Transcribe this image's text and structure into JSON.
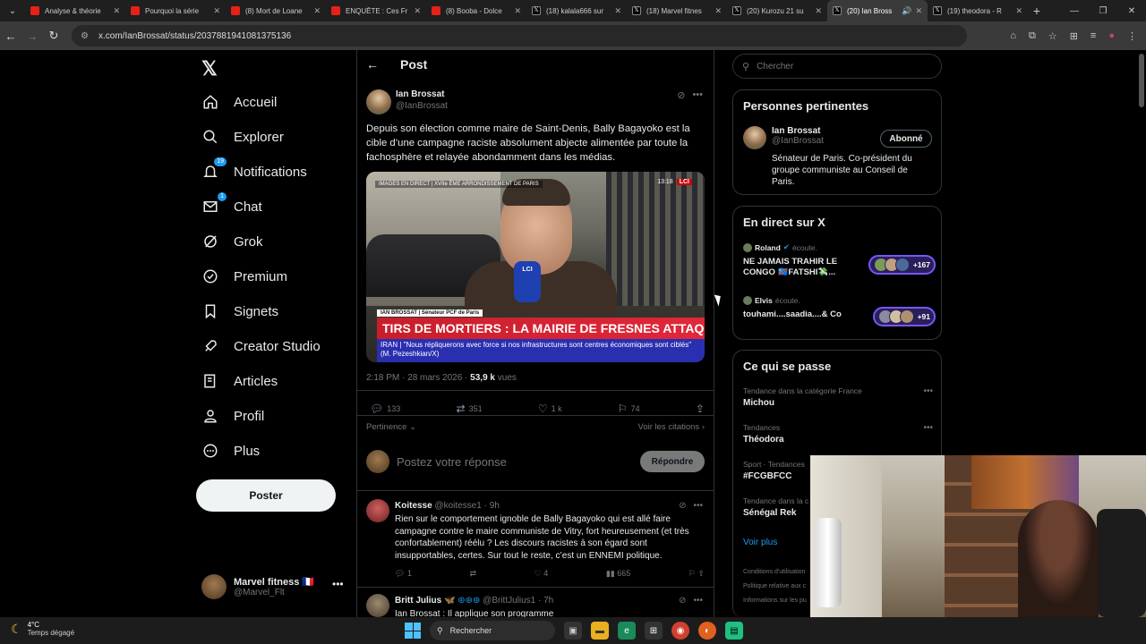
{
  "browser": {
    "tabs": [
      {
        "title": "Analyse & théorie",
        "kind": "yt"
      },
      {
        "title": "Pourquoi la série",
        "kind": "yt"
      },
      {
        "title": "(8) Mort de Loane",
        "kind": "yt"
      },
      {
        "title": "ENQUÊTE : Ces Fr",
        "kind": "yt"
      },
      {
        "title": "(8) Booba - Dolce",
        "kind": "yt"
      },
      {
        "title": "(18) kalala666 sur",
        "kind": "x"
      },
      {
        "title": "(18) Marvel fitnes",
        "kind": "x"
      },
      {
        "title": "(20) Kurozu 21 su",
        "kind": "x"
      },
      {
        "title": "(20) Ian Bross",
        "kind": "x",
        "active": true
      },
      {
        "title": "(19) theodora - R",
        "kind": "x"
      }
    ],
    "url": "x.com/IanBrossat/status/2037881941081375136"
  },
  "nav": {
    "items": [
      {
        "label": "Accueil",
        "icon": "home-icon"
      },
      {
        "label": "Explorer",
        "icon": "search-icon"
      },
      {
        "label": "Notifications",
        "icon": "bell-icon",
        "badge": "19"
      },
      {
        "label": "Chat",
        "icon": "mail-icon",
        "badge": "1"
      },
      {
        "label": "Grok",
        "icon": "grok-icon"
      },
      {
        "label": "Premium",
        "icon": "premium-icon"
      },
      {
        "label": "Signets",
        "icon": "bookmark-icon"
      },
      {
        "label": "Creator Studio",
        "icon": "rocket-icon"
      },
      {
        "label": "Articles",
        "icon": "article-icon"
      },
      {
        "label": "Profil",
        "icon": "person-icon"
      },
      {
        "label": "Plus",
        "icon": "more-circle-icon"
      }
    ],
    "post_button": "Poster",
    "account": {
      "name": "Marvel fitness 🇫🇷",
      "handle": "@Marvel_Flt"
    }
  },
  "post": {
    "header": "Post",
    "author_name": "Ian Brossat",
    "author_handle": "@IanBrossat",
    "text": "Depuis son élection comme maire de Saint-Denis, Bally Bagayoko est la cible d’une campagne raciste absolument abjecte alimentée par toute la fachosphère et relayée abondamment dans les médias.",
    "media": {
      "top_label": "IMAGES EN DIRECT | XVIIe ÈME ARRONDISSEMENT DE PARIS",
      "channel": "LCI",
      "time": "13:18",
      "lower_third": "IAN BROSSAT | Sénateur PCF de Paris",
      "headline": "TIRS DE MORTIERS : LA MAIRIE DE FRESNES ATTAQUÉE",
      "ticker": "IRAN | \"Nous répliquerons avec force si nos infrastructures sont centres économiques sont ciblés\" (M. Pezeshkian/X)"
    },
    "timestamp": "2:18 PM · 28 mars 2026 · ",
    "views_count": "53,9 k",
    "views_label": " vues",
    "stats": {
      "replies": "133",
      "reposts": "351",
      "likes": "1 k",
      "bookmarks": "74"
    },
    "sort_label": "Pertinence",
    "quotes_label": "Voir les citations",
    "reply_placeholder": "Postez votre réponse",
    "reply_button": "Répondre"
  },
  "replies": [
    {
      "name": "Koitesse",
      "handle": "@koitesse1 · 9h",
      "text": "Rien sur le comportement ignoble de Bally Bagayoko qui est allé faire campagne contre le maire communiste de Vitry, fort heureusement (et très confortablement) réélu ? Les discours racistes à son égard sont insupportables, certes. Sur tout le reste, c’est un ENNEMI politique.",
      "stats": {
        "replies": "1",
        "reposts": "",
        "likes": "4",
        "views": "665"
      }
    },
    {
      "name": "Britt Julius 🦋",
      "handle": "@BrittJulius1 · 7h",
      "text": "Ian Brossat : Il applique son programme",
      "stats": {
        "replies": "",
        "reposts": "",
        "likes": "",
        "views": ""
      }
    }
  ],
  "sidebar": {
    "search_placeholder": "Chercher",
    "relevant": {
      "title": "Personnes pertinentes",
      "name": "Ian Brossat",
      "handle": "@IanBrossat",
      "follow_label": "Abonné",
      "bio": "Sénateur de Paris. Co-président du groupe communiste au Conseil de Paris."
    },
    "live": {
      "title": "En direct sur X",
      "items": [
        {
          "host": "Roland",
          "action": "écoute.",
          "title": "NE JAMAIS TRAHIR LE CONGO 🇨🇩FATSHI💸...",
          "count": "+167"
        },
        {
          "host": "Elvis",
          "action": "écoute.",
          "title": "touhami....saadia....& Co",
          "count": "+91"
        }
      ]
    },
    "trends": {
      "title": "Ce qui se passe",
      "items": [
        {
          "category": "Tendance dans la catégorie France",
          "name": "Michou"
        },
        {
          "category": "Tendances",
          "name": "Théodora"
        },
        {
          "category": "Sport · Tendances",
          "name": "#FCGBFCC"
        },
        {
          "category": "Tendance dans la c",
          "name": "Sénégal Rek"
        }
      ],
      "see_more": "Voir plus"
    },
    "footer": [
      "Conditions d'utilisation",
      "Politique relative aux c",
      "Informations sur les pu"
    ]
  },
  "taskbar": {
    "temp": "4°C",
    "weather": "Temps dégagé",
    "search": "Rechercher"
  }
}
